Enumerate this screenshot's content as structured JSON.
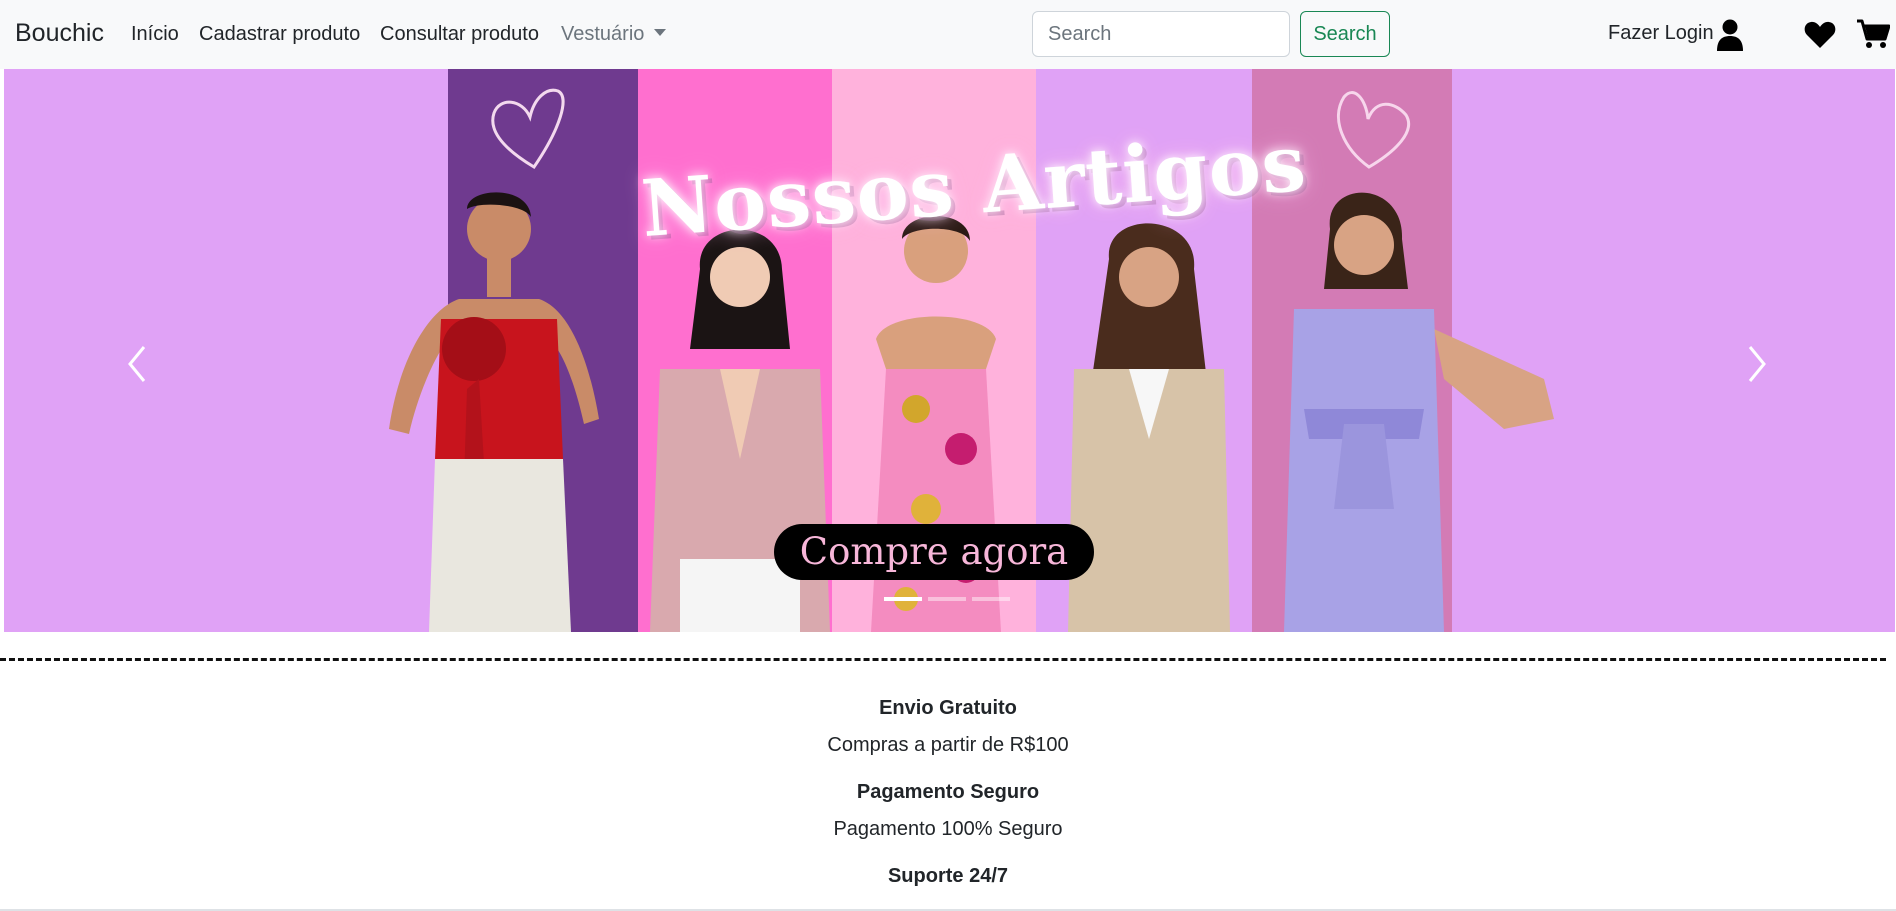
{
  "navbar": {
    "brand": "Bouchic",
    "links": [
      "Início",
      "Cadastrar produto",
      "Consultar produto"
    ],
    "dropdown_label": "Vestuário",
    "search_placeholder": "Search",
    "search_button": "Search",
    "login_label": "Fazer Login"
  },
  "icons": {
    "user": "user-icon",
    "favorites": "heart-icon",
    "cart": "cart-icon",
    "prev": "chevron-left-icon",
    "next": "chevron-right-icon"
  },
  "carousel": {
    "headline": "Nossos Artigos",
    "cta_label": "Compre agora",
    "slide_count": 3,
    "active_slide": 1,
    "background_color": "#e0a2f6",
    "stripe_colors": [
      "#6f3a8f",
      "#ff6fcf",
      "#ffb2dc",
      "#e0a2f6",
      "#d37bb5"
    ]
  },
  "features": [
    {
      "title": "Envio Gratuito",
      "text": "Compras a partir de R$100"
    },
    {
      "title": "Pagamento Seguro",
      "text": "Pagamento 100% Seguro"
    },
    {
      "title": "Suporte 24/7",
      "text": ""
    }
  ],
  "colors": {
    "navbar_bg": "#f8f9fa",
    "search_button": "#198754",
    "cta_bg": "#000000",
    "cta_text": "#f7b6d9"
  }
}
